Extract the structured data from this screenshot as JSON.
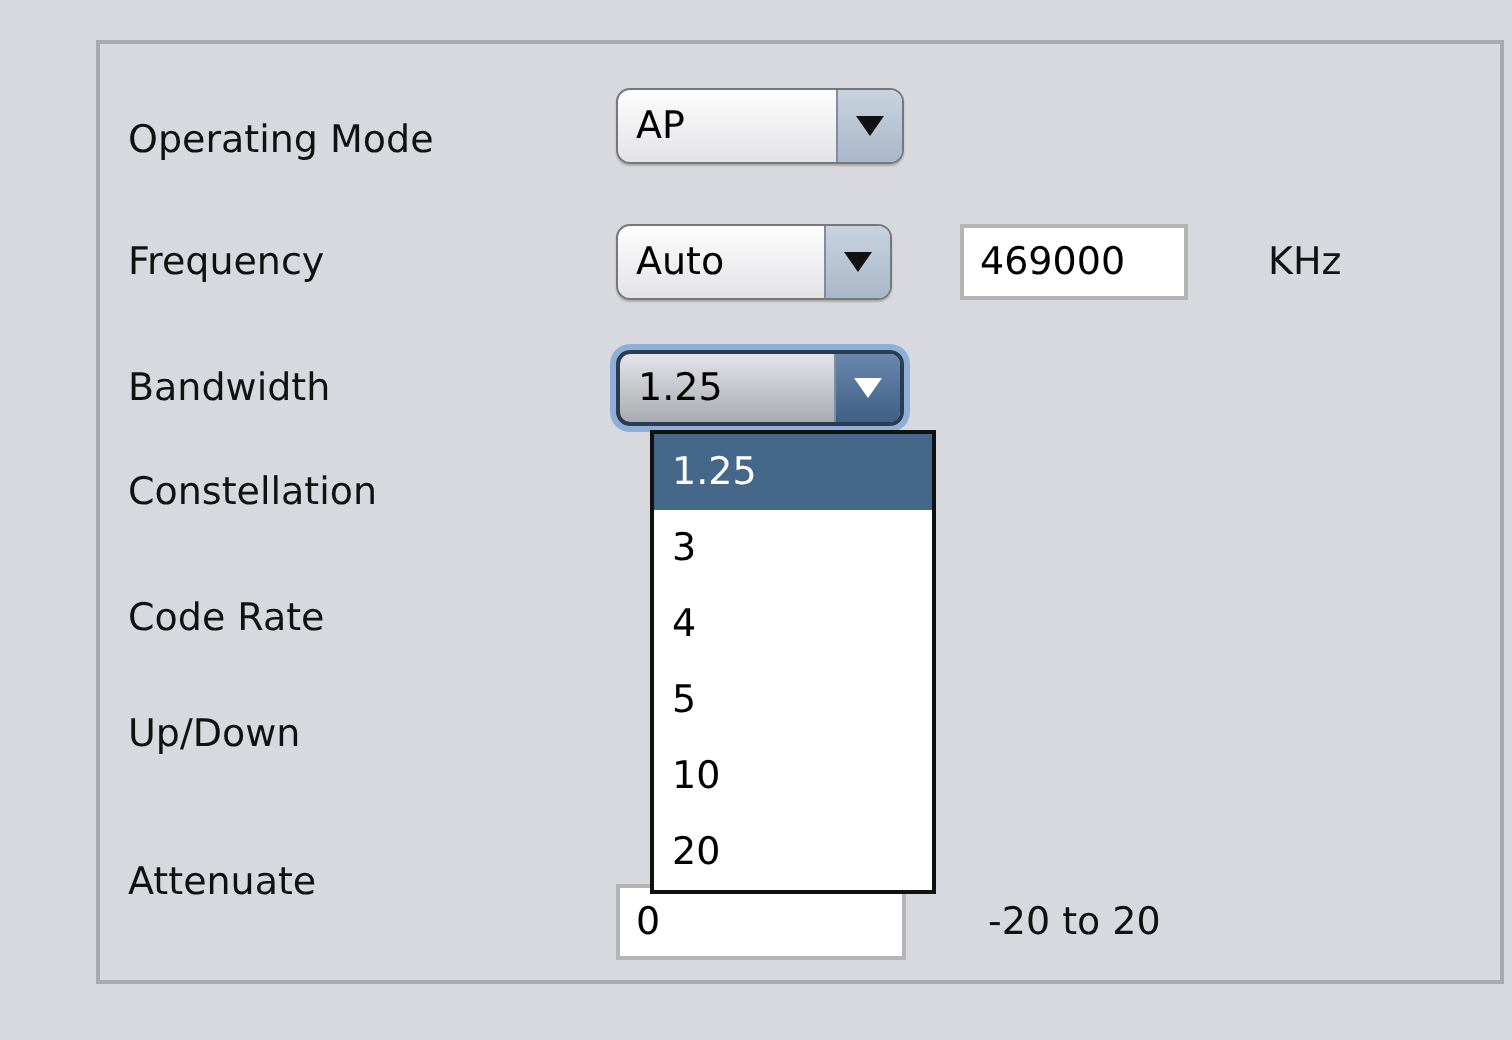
{
  "rows": [
    {
      "label": "Operating Mode",
      "kind": "combo",
      "value": "AP",
      "expanded": false
    },
    {
      "label": "Frequency",
      "kind": "combo_field",
      "value": "Auto",
      "expanded": false,
      "field": "469000",
      "unit": "KHz"
    },
    {
      "label": "Bandwidth",
      "kind": "combo",
      "value": "1.25",
      "expanded": true,
      "options": [
        {
          "label": "1.25",
          "selected": true
        },
        {
          "label": "3",
          "selected": false
        },
        {
          "label": "4",
          "selected": false
        },
        {
          "label": "5",
          "selected": false
        },
        {
          "label": "10",
          "selected": false
        },
        {
          "label": "20",
          "selected": false
        }
      ]
    },
    {
      "label": "Constellation",
      "kind": "label"
    },
    {
      "label": "Code Rate",
      "kind": "label"
    },
    {
      "label": "Up/Down",
      "kind": "label"
    },
    {
      "label": "Attenuate",
      "kind": "field",
      "field": "0",
      "unit": "-20 to 20"
    }
  ]
}
